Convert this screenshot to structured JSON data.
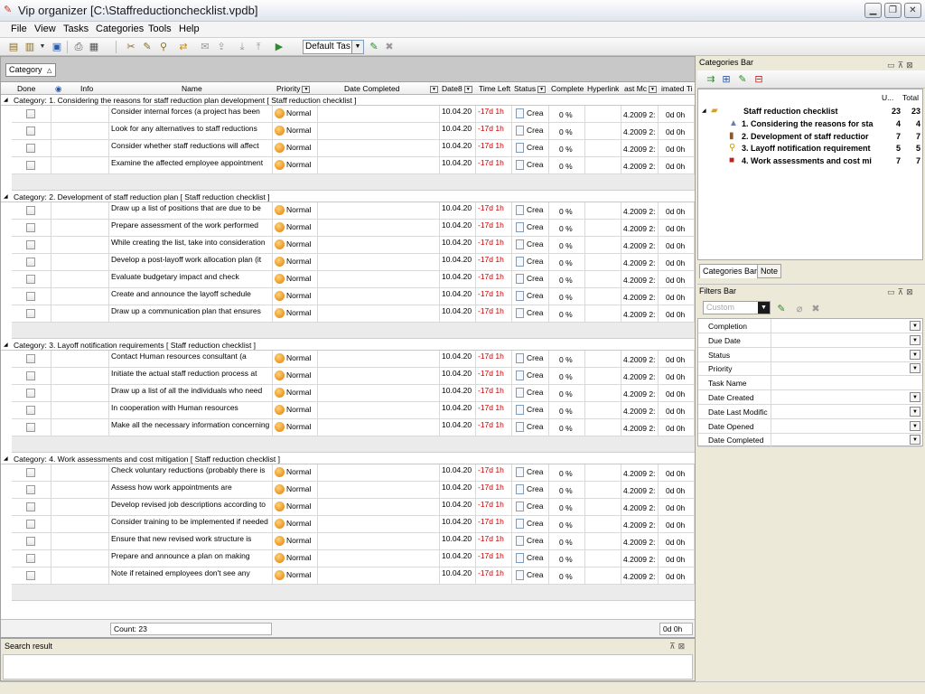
{
  "window": {
    "title": "Vip organizer [C:\\Staffreductionchecklist.vpdb]"
  },
  "menu": [
    "File",
    "View",
    "Tasks",
    "Categories",
    "Tools",
    "Help"
  ],
  "toolbar": {
    "view_combo": "Default Tas"
  },
  "group_panel": {
    "chip": "Category"
  },
  "columns": {
    "done": "Done",
    "info": "Info",
    "name": "Name",
    "priority": "Priority",
    "date_completed": "Date Completed",
    "date": "Date8",
    "time_left": "Time Left",
    "status": "Status",
    "complete": "Complete",
    "hyperlink": "Hyperlink",
    "last_mod": "ast Mc",
    "estimated": "imated Ti"
  },
  "row_common": {
    "priority": "Normal",
    "date": "10.04.20",
    "time_left": "-17d 1h",
    "status": "Crea",
    "complete": "0 %",
    "last_mod": "4.2009 2:",
    "estimated": "0d 0h"
  },
  "categories": [
    {
      "header": "Category: 1. Considering the reasons for staff reduction plan development   [ Staff reduction checklist ]",
      "tasks": [
        "Consider internal forces (a project has been",
        "Look for any alternatives to staff reductions",
        "Consider whether staff reductions will affect",
        "Examine the affected employee appointment"
      ]
    },
    {
      "header": "Category: 2. Development of staff reduction plan   [ Staff reduction checklist ]",
      "tasks": [
        "Draw up a list of positions that are due to be",
        "Prepare assessment of the work performed",
        "While creating the list, take into consideration",
        "Develop a post-layoff work allocation plan (it",
        "Evaluate budgetary impact and check",
        "Create and announce the layoff schedule",
        "Draw up a communication plan that ensures"
      ]
    },
    {
      "header": "Category: 3. Layoff notification requirements   [ Staff reduction checklist ]",
      "tasks": [
        "Contact Human resources consultant (a",
        "Initiate the actual staff reduction process at",
        "Draw up a list of all the individuals who need",
        "In cooperation with Human resources",
        "Make all the necessary information concerning"
      ]
    },
    {
      "header": "Category: 4. Work assessments and cost mitigation   [ Staff reduction checklist ]",
      "tasks": [
        "Check voluntary reductions (probably there is",
        "Assess how work appointments are",
        "Develop revised job descriptions according to",
        "Consider training to be implemented if needed",
        "Ensure that new revised work structure is",
        "Prepare and announce a plan on making",
        "Note if retained employees don't see any"
      ]
    }
  ],
  "footer": {
    "count": "Count: 23",
    "sum": "0d 0h"
  },
  "search_panel": {
    "title": "Search result"
  },
  "categories_bar": {
    "title": "Categories Bar",
    "col_u": "U...",
    "col_total": "Total",
    "root": {
      "label": "Staff reduction checklist",
      "u": "23",
      "total": "23"
    },
    "items": [
      {
        "label": "1. Considering the reasons for sta",
        "u": "4",
        "total": "4"
      },
      {
        "label": "2. Development of staff reductior",
        "u": "7",
        "total": "7"
      },
      {
        "label": "3. Layoff notification requirement",
        "u": "5",
        "total": "5"
      },
      {
        "label": "4. Work assessments and cost mi",
        "u": "7",
        "total": "7"
      }
    ],
    "tabs": [
      "Categories Bar",
      "Note"
    ]
  },
  "filters_bar": {
    "title": "Filters Bar",
    "combo": "Custom",
    "rows": [
      {
        "label": "Completion",
        "dd": true
      },
      {
        "label": "Due Date",
        "dd": true
      },
      {
        "label": "Status",
        "dd": true
      },
      {
        "label": "Priority",
        "dd": true
      },
      {
        "label": "Task Name",
        "dd": false
      },
      {
        "label": "Date Created",
        "dd": true
      },
      {
        "label": "Date Last Modific",
        "dd": true
      },
      {
        "label": "Date Opened",
        "dd": true
      },
      {
        "label": "Date Completed",
        "dd": true
      }
    ]
  }
}
